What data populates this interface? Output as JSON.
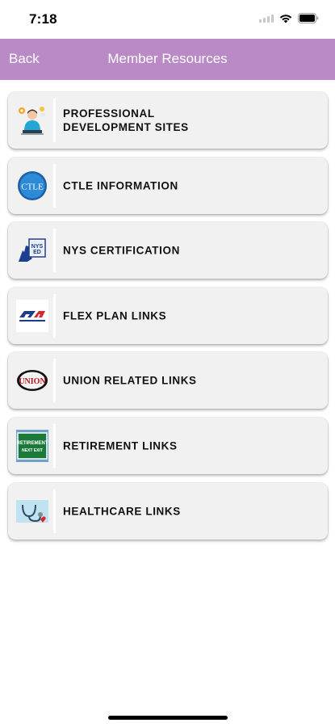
{
  "status_bar": {
    "time": "7:18"
  },
  "nav": {
    "back_label": "Back",
    "title": "Member Resources"
  },
  "items": [
    {
      "label": "PROFESSIONAL\nDEVELOPMENT SITES",
      "icon": "teacher-icon"
    },
    {
      "label": "CTLE INFORMATION",
      "icon": "ctle-logo-icon",
      "icon_text": "CTLE"
    },
    {
      "label": "NYS CERTIFICATION",
      "icon": "nys-ed-icon",
      "icon_text": "NYS ED"
    },
    {
      "label": "FLEX PLAN LINKS",
      "icon": "flex-plan-logo-icon"
    },
    {
      "label": "UNION RELATED LINKS",
      "icon": "union-logo-icon",
      "icon_text": "UNION"
    },
    {
      "label": "RETIREMENT LINKS",
      "icon": "retirement-sign-icon",
      "icon_text": "RETIREMENT NEXT EXIT"
    },
    {
      "label": "HEALTHCARE LINKS",
      "icon": "stethoscope-icon"
    }
  ],
  "colors": {
    "nav_background": "#b98ac6",
    "card_background": "#f1f1f1"
  }
}
